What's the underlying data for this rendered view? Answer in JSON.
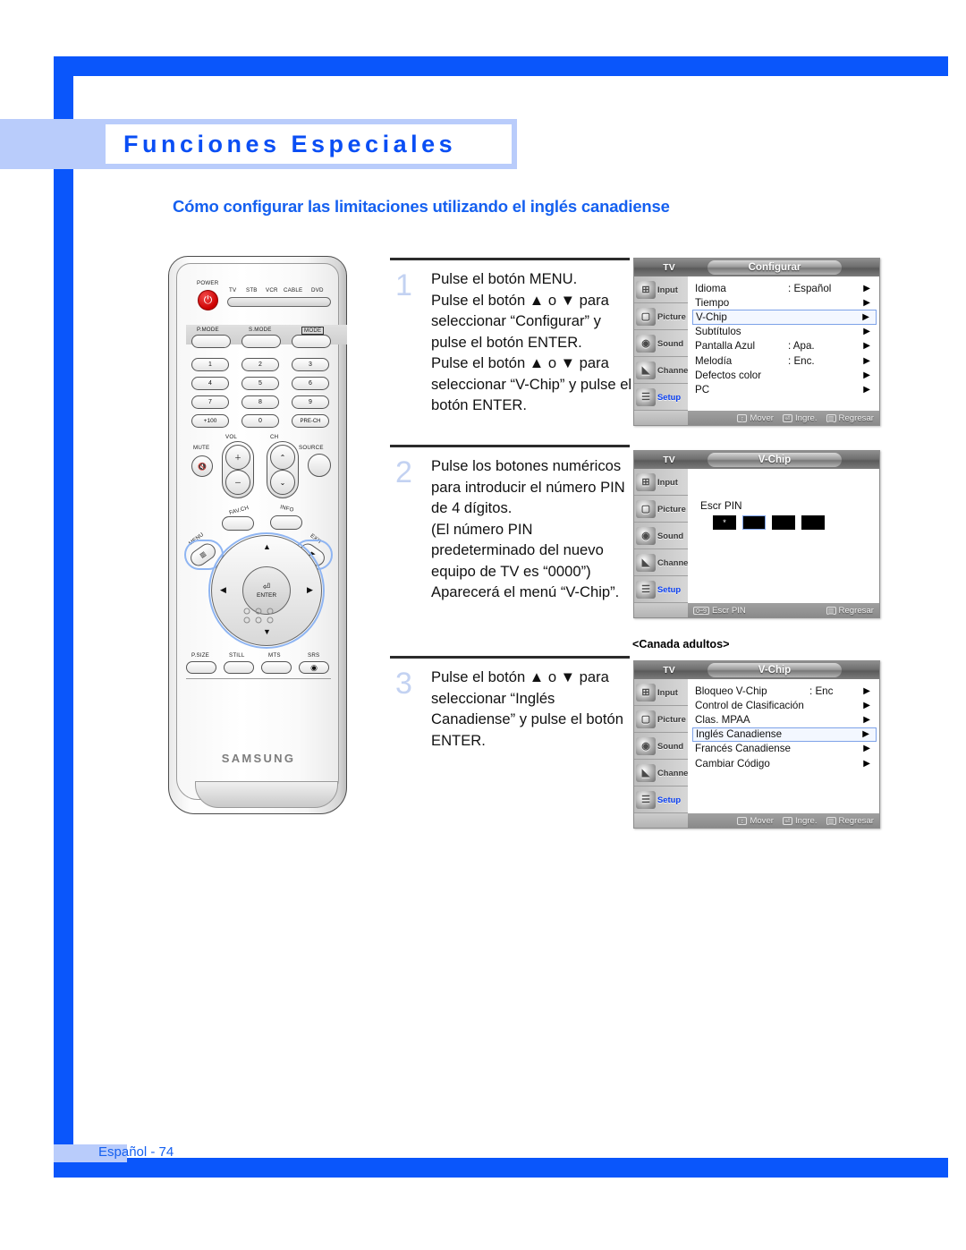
{
  "page": {
    "chapter_title": "Funciones Especiales",
    "section_title": "Cómo configurar las limitaciones utilizando el inglés canadiense",
    "footer": "Español - 74",
    "accent_blue": "#0a56fb",
    "accent_light": "#b9ccfb",
    "step_number_color": "#c3d2f2"
  },
  "remote": {
    "brand": "SAMSUNG",
    "power_label": "POWER",
    "power_icon": "power-icon",
    "mode_labels": [
      "TV",
      "STB",
      "VCR",
      "CABLE",
      "DVD"
    ],
    "mode_buttons": [
      "P.MODE",
      "S.MODE",
      "MODE"
    ],
    "keypad": [
      "1",
      "2",
      "3",
      "4",
      "5",
      "6",
      "7",
      "8",
      "9",
      "+100",
      "0",
      "PRE-CH"
    ],
    "vol_label": "VOL",
    "ch_label": "CH",
    "mute_label": "MUTE",
    "source_label": "SOURCE",
    "fav_label": "FAV.CH",
    "info_label": "INFO",
    "menu_label": "MENU",
    "exit_label": "EXIT",
    "enter_label": "ENTER",
    "bottom_buttons": [
      "P.SIZE",
      "STILL",
      "MTS",
      "SRS"
    ]
  },
  "steps": [
    {
      "number": "1",
      "text": "Pulse el botón MENU.\nPulse el botón ▲ o ▼ para seleccionar “Configurar” y pulse el botón ENTER.\nPulse el botón ▲ o ▼ para seleccionar “V-Chip” y pulse el botón ENTER."
    },
    {
      "number": "2",
      "text": "Pulse los botones numéricos para introducir el número PIN de 4 dígitos.\n(El número PIN predeterminado del nuevo equipo de TV es “0000”)\nAparecerá el menú “V-Chip”."
    },
    {
      "number": "3",
      "text": "Pulse el botón ▲ o ▼ para seleccionar “Inglés Canadiense” y pulse el botón ENTER."
    }
  ],
  "osd_sidebar": [
    {
      "label": "Input",
      "icon": "input-icon",
      "active": false
    },
    {
      "label": "Picture",
      "icon": "picture-icon",
      "active": false
    },
    {
      "label": "Sound",
      "icon": "sound-icon",
      "active": false
    },
    {
      "label": "Channel",
      "icon": "channel-icon",
      "active": false
    },
    {
      "label": "Setup",
      "icon": "setup-icon",
      "active": true
    }
  ],
  "osd_bottom_move": {
    "key": "↕",
    "label": "Mover"
  },
  "osd_bottom_enter": {
    "key": "⏎",
    "label": "Ingre."
  },
  "osd_bottom_return": {
    "key": "▥",
    "label": "Regresar"
  },
  "menu1": {
    "tv_label": "TV",
    "title": "Configurar",
    "rows": [
      {
        "label": "Idioma",
        "value": ": Español",
        "selected": false
      },
      {
        "label": "Tiempo",
        "value": "",
        "selected": false
      },
      {
        "label": "V-Chip",
        "value": "",
        "selected": true
      },
      {
        "label": "Subtítulos",
        "value": "",
        "selected": false
      },
      {
        "label": "Pantalla Azul",
        "value": ": Apa.",
        "selected": false
      },
      {
        "label": "Melodía",
        "value": ": Enc.",
        "selected": false
      },
      {
        "label": "Defectos color",
        "value": "",
        "selected": false
      },
      {
        "label": "PC",
        "value": "",
        "selected": false
      }
    ]
  },
  "menu2": {
    "tv_label": "TV",
    "title": "V-Chip",
    "pin_label": "Escr PIN",
    "pin_boxes": [
      {
        "value": "*",
        "current": false
      },
      {
        "value": "",
        "current": true
      },
      {
        "value": "",
        "current": false
      },
      {
        "value": "",
        "current": false
      }
    ],
    "bottom_keys": {
      "key": "0~9",
      "label": "Escr PIN"
    },
    "bottom_return": {
      "key": "▥",
      "label": "Regresar"
    }
  },
  "menu3": {
    "caption": "<Canada adultos>",
    "tv_label": "TV",
    "title": "V-Chip",
    "rows": [
      {
        "label": "Bloqueo V-Chip",
        "value": ": Enc",
        "selected": false
      },
      {
        "label": "Control de Clasificación",
        "value": "",
        "selected": false
      },
      {
        "label": "Clas. MPAA",
        "value": "",
        "selected": false
      },
      {
        "label": "Inglés Canadiense",
        "value": "",
        "selected": true
      },
      {
        "label": "Francés Canadiense",
        "value": "",
        "selected": false
      },
      {
        "label": "Cambiar Código",
        "value": "",
        "selected": false
      }
    ]
  }
}
